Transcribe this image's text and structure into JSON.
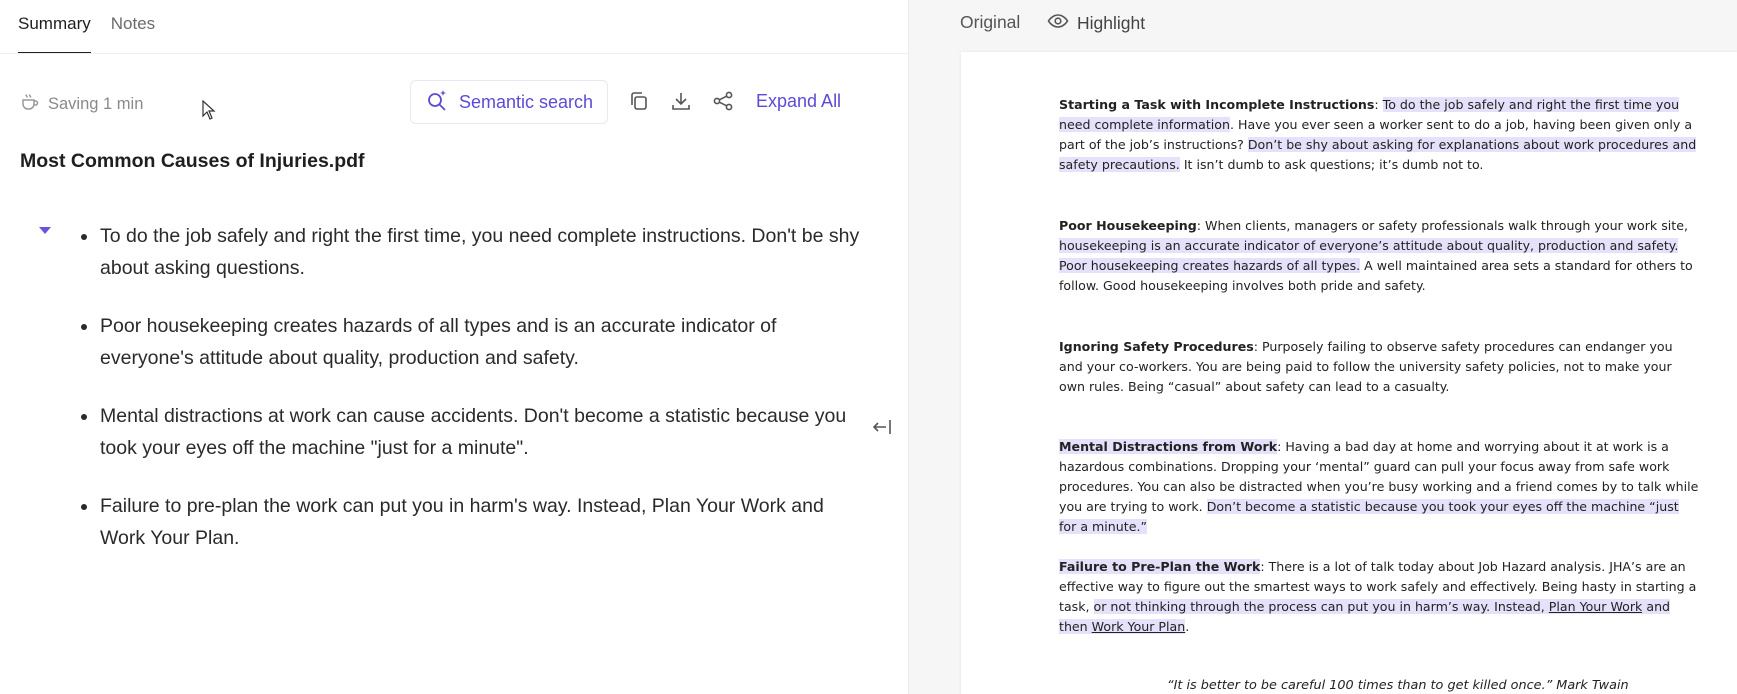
{
  "tabs": {
    "summary": "Summary",
    "notes": "Notes"
  },
  "toolbar": {
    "saving": "Saving 1 min",
    "semantic_search": "Semantic search",
    "expand_all": "Expand All"
  },
  "document": {
    "title": "Most Common Causes of Injuries.pdf"
  },
  "summary": {
    "bullets": [
      "To do the job safely and right the first time, you need complete instructions. Don't be shy about asking questions.",
      "Poor housekeeping creates hazards of all types and is an accurate indicator of everyone's attitude about quality, production and safety.",
      "Mental distractions at work can cause accidents. Don't become a statistic because you took your eyes off the machine \"just for a minute\".",
      "Failure to pre-plan the work can put you in harm's way. Instead, Plan Your Work and Work Your Plan."
    ]
  },
  "viewer": {
    "original": "Original",
    "highlight": "Highlight",
    "p1": {
      "heading": "Starting a Task with Incomplete Instructions",
      "s1": "To do the job safely and right the first time you need complete information",
      "s2": ".  Have you ever seen a worker sent to do a job, having been given only a part of the job’s instructions?  ",
      "s3": "Don’t be shy about asking for explanations about work procedures and safety precautions.",
      "s4": "  It isn’t dumb to ask questions; it’s dumb not to."
    },
    "p2": {
      "heading": "Poor Housekeeping",
      "s1": ": When clients, managers or safety professionals walk through your work site, ",
      "s2": "housekeeping is an accurate indicator of everyone’s attitude about quality, production and safety.  Poor housekeeping creates hazards of all types.",
      "s3": "  A well maintained area sets a standard for others to follow.  Good housekeeping involves both pride and safety."
    },
    "p3": {
      "heading": "Ignoring Safety Procedures",
      "s1": ": Purposely failing to observe safety procedures can endanger you and your co-workers.  You are being paid to follow the university safety policies, not to make your own rules.  Being “casual” about safety can lead to a casualty."
    },
    "p4": {
      "heading": "Mental Distractions from Work",
      "s1": ": Having a bad day at home and worrying about it at work is a hazardous combinations.  Dropping your ‘mental” guard can pull your focus away from safe work procedures.  You can also be distracted when you’re busy working and a friend comes by to talk while you are trying to work.  ",
      "s2": "Don’t become a statistic because you took your eyes off the machine “just for a minute.”"
    },
    "p5": {
      "heading": "Failure to Pre-Plan the Work",
      "s1": ": There is a lot of talk today about Job Hazard analysis.  JHA’s are an effective way to figure out the smartest ways to work safely and effectively.  Being hasty in starting a task, ",
      "s2": "or not thinking through the process can put you in harm’s way.  Instead, ",
      "s3": "Plan Your Work",
      "s4": " and then ",
      "s5": "Work Your Plan",
      "s6": "."
    },
    "quote": "“It is better to be careful 100 times than to get killed once.”  Mark Twain"
  },
  "colors": {
    "accent": "#5b4bd6",
    "highlight": "#e6e1fb"
  }
}
